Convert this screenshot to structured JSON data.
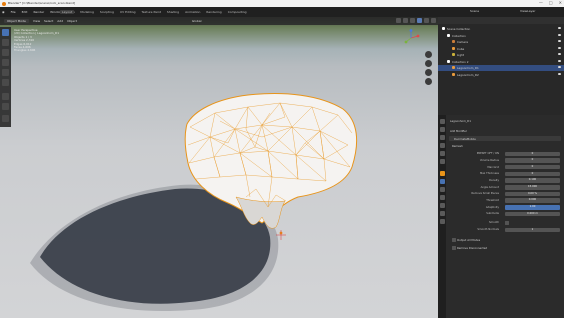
{
  "window": {
    "title": "Blender* [C:\\Blender\\scene\\rock_scan.blend]",
    "controls": [
      "—",
      "□",
      "✕"
    ]
  },
  "menu": {
    "items": [
      "File",
      "Edit",
      "Render",
      "Window",
      "Help"
    ],
    "workspaces": [
      "Layout",
      "Modeling",
      "Sculpting",
      "UV Editing",
      "Texture Paint",
      "Shading",
      "Animation",
      "Rendering",
      "Compositing"
    ],
    "active_workspace": "Layout",
    "scene": "Scene",
    "view_layer": "ViewLayer"
  },
  "viewport": {
    "mode": "Object Mode",
    "menus": [
      "View",
      "Select",
      "Add",
      "Object"
    ],
    "transform": "Global",
    "info": [
      "User Perspective",
      "(20) Collection | Lagoonhom_D1",
      "Objects  1 / 3",
      "Vertices  2,316",
      "Edges  6,912",
      "Faces  4,606",
      "Triangles  4,606"
    ]
  },
  "outliner": {
    "rows": [
      {
        "label": "Scene Collection",
        "depth": 0,
        "color": "#ffffff",
        "selected": false
      },
      {
        "label": "Collection",
        "depth": 1,
        "color": "#ffffff",
        "selected": false
      },
      {
        "label": "Camera",
        "depth": 2,
        "color": "#c97d3a",
        "selected": false
      },
      {
        "label": "Cube",
        "depth": 2,
        "color": "#e89a3c",
        "selected": false
      },
      {
        "label": "Light",
        "depth": 2,
        "color": "#c9b13a",
        "selected": false
      },
      {
        "label": "Collection 2",
        "depth": 1,
        "color": "#ffffff",
        "selected": false
      },
      {
        "label": "Lagoonhom_D1",
        "depth": 2,
        "color": "#e89a3c",
        "selected": true
      },
      {
        "label": "Lagoonhom_D2",
        "depth": 2,
        "color": "#e89a3c",
        "selected": false
      }
    ]
  },
  "properties": {
    "object": "Lagoonhom_D1",
    "modifier_section": "Add Modifier",
    "modifier_name": "DecimateMobile",
    "remesh_label": "Remesh",
    "fields": [
      {
        "label": "PRESET OFF / ON",
        "value": "0"
      },
      {
        "label": "Volume Radius",
        "value": "0"
      },
      {
        "label": "Max Grid",
        "value": "0"
      },
      {
        "label": "Max Thickness",
        "value": "0"
      },
      {
        "label": "Density",
        "value": "0.100"
      },
      {
        "label": "Angle Amount",
        "value": "15.000"
      },
      {
        "label": "Remove Small Pieces",
        "value": "0.00 %"
      },
      {
        "label": "Threshold",
        "value": "0.000"
      },
      {
        "label": "Adaptivity",
        "value": "1.00",
        "highlight": true
      },
      {
        "label": "Subdivide",
        "value": "0.000 m"
      }
    ],
    "smooth_label": "Smooth",
    "smooth_normals": "Smooth Normals",
    "smooth_value": "1",
    "output_label": "Output All Modes",
    "remove_label": "Remove Disconnected"
  },
  "colors": {
    "accent_orange": "#e8941a",
    "selection_blue": "#4772b3",
    "ui_dark": "#282828"
  }
}
